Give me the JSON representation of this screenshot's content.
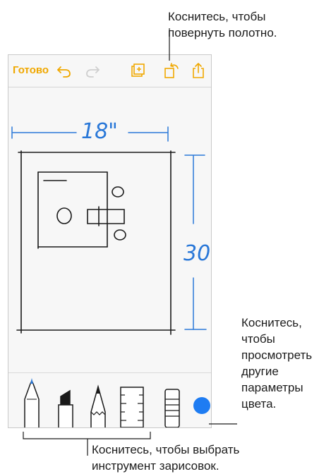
{
  "callouts": {
    "rotate": "Коснитесь, чтобы\nповернуть полотно.",
    "colors": "Коснитесь,\nчтобы\nпросмотреть\nдругие\nпараметры\nцвета.",
    "tools": "Коснитесь, чтобы выбрать\nинструмент зарисовок."
  },
  "toolbar": {
    "done_label": "Готово",
    "icons": [
      "undo-icon",
      "redo-icon",
      "add-page-icon",
      "rotate-canvas-icon",
      "share-icon"
    ]
  },
  "drawing": {
    "width_label": "18\"",
    "height_label": "30\""
  },
  "tools": {
    "items": [
      "pen-tool",
      "marker-tool",
      "pencil-tool",
      "ruler-tool",
      "eraser-tool"
    ],
    "selected_color": "#1e7cf2"
  },
  "colors": {
    "accent": "#f0a800",
    "ink": "#1a1a1a",
    "blue_ink": "#2a78d8"
  }
}
